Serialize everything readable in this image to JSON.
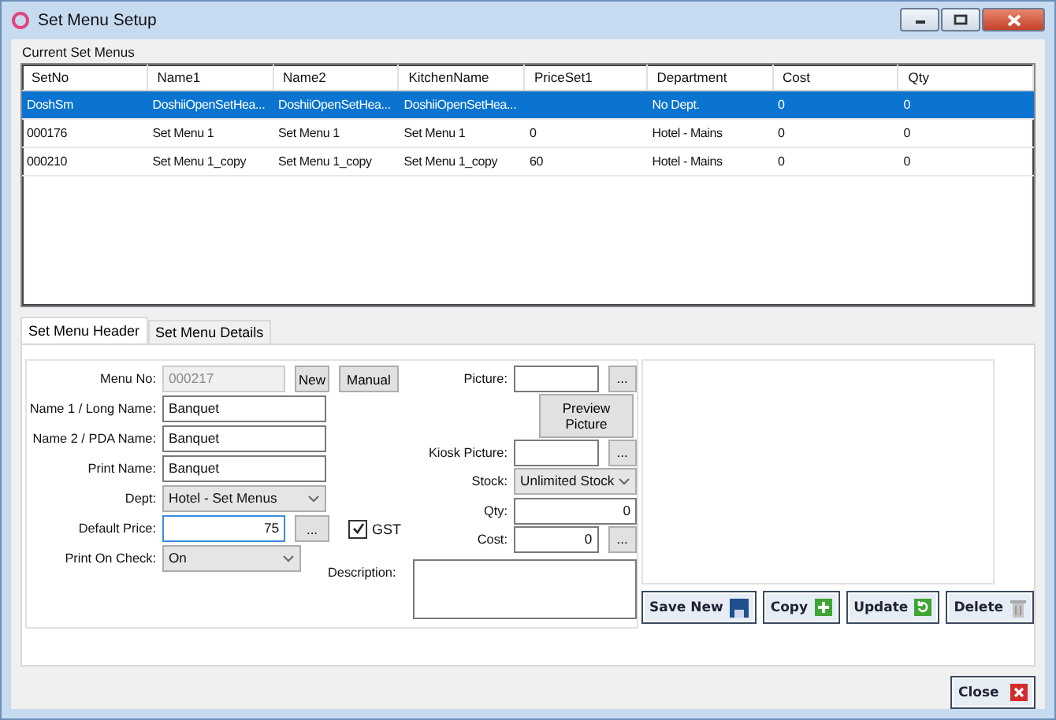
{
  "window": {
    "title": "Set Menu Setup"
  },
  "list_label": "Current Set Menus",
  "table": {
    "columns": [
      "SetNo",
      "Name1",
      "Name2",
      "KitchenName",
      "PriceSet1",
      "Department",
      "Cost",
      "Qty"
    ],
    "rows": [
      {
        "selected": true,
        "cells": [
          "DoshSm",
          "DoshiiOpenSetHea...",
          "DoshiiOpenSetHea...",
          "DoshiiOpenSetHea...",
          "",
          "No Dept.",
          "0",
          "0"
        ]
      },
      {
        "selected": false,
        "cells": [
          "000176",
          "Set Menu 1",
          "Set Menu 1",
          "Set Menu 1",
          "0",
          "Hotel - Mains",
          "0",
          "0"
        ]
      },
      {
        "selected": false,
        "cells": [
          "000210",
          "Set Menu 1_copy",
          "Set Menu 1_copy",
          "Set Menu 1_copy",
          "60",
          "Hotel - Mains",
          "0",
          "0"
        ]
      }
    ]
  },
  "tabs": [
    {
      "label": "Set Menu Header",
      "selected": true
    },
    {
      "label": "Set Menu Details",
      "selected": false
    }
  ],
  "left_fields": [
    {
      "label": "Menu No:",
      "kind": "text",
      "value": "000217",
      "disabled": true,
      "buttons": [
        "New",
        "Manual"
      ]
    },
    {
      "label": "Name 1 / Long Name:",
      "kind": "text",
      "value": "Banquet",
      "disabled": false
    },
    {
      "label": "Name 2 / PDA Name:",
      "kind": "text",
      "value": "Banquet",
      "disabled": false
    },
    {
      "label": "Print Name:",
      "kind": "text",
      "value": "Banquet",
      "disabled": false
    },
    {
      "label": "Dept:",
      "kind": "select",
      "value": "Hotel - Set Menus"
    },
    {
      "label": "Default Price:",
      "kind": "number",
      "value": "75",
      "disabled": false,
      "focused": true,
      "buttons": [
        "..."
      ],
      "checkbox": {
        "label": "GST",
        "checked": true
      }
    },
    {
      "label": "Print On Check:",
      "kind": "select",
      "value": "On"
    }
  ],
  "right_fields": [
    {
      "label": "Picture:",
      "kind": "text",
      "buttons": [
        "..."
      ]
    },
    {
      "label": "Preview Picture",
      "kind": "button"
    },
    {
      "label": "Kiosk Picture:",
      "kind": "text",
      "buttons": [
        "..."
      ]
    },
    {
      "label": "Stock:",
      "kind": "select",
      "value": "Unlimited Stock"
    },
    {
      "label": "Qty:",
      "kind": "number",
      "value": "0"
    },
    {
      "label": "Cost:",
      "kind": "number",
      "value": "0",
      "buttons": [
        "..."
      ]
    },
    {
      "label": "Description:",
      "kind": "textarea"
    }
  ],
  "actions": [
    {
      "label": "Save New",
      "kind": "save"
    },
    {
      "label": "Copy",
      "kind": "add"
    },
    {
      "label": "Update",
      "kind": "refresh"
    },
    {
      "label": "Delete",
      "kind": "trash"
    }
  ],
  "close_button": {
    "label": "Close"
  }
}
